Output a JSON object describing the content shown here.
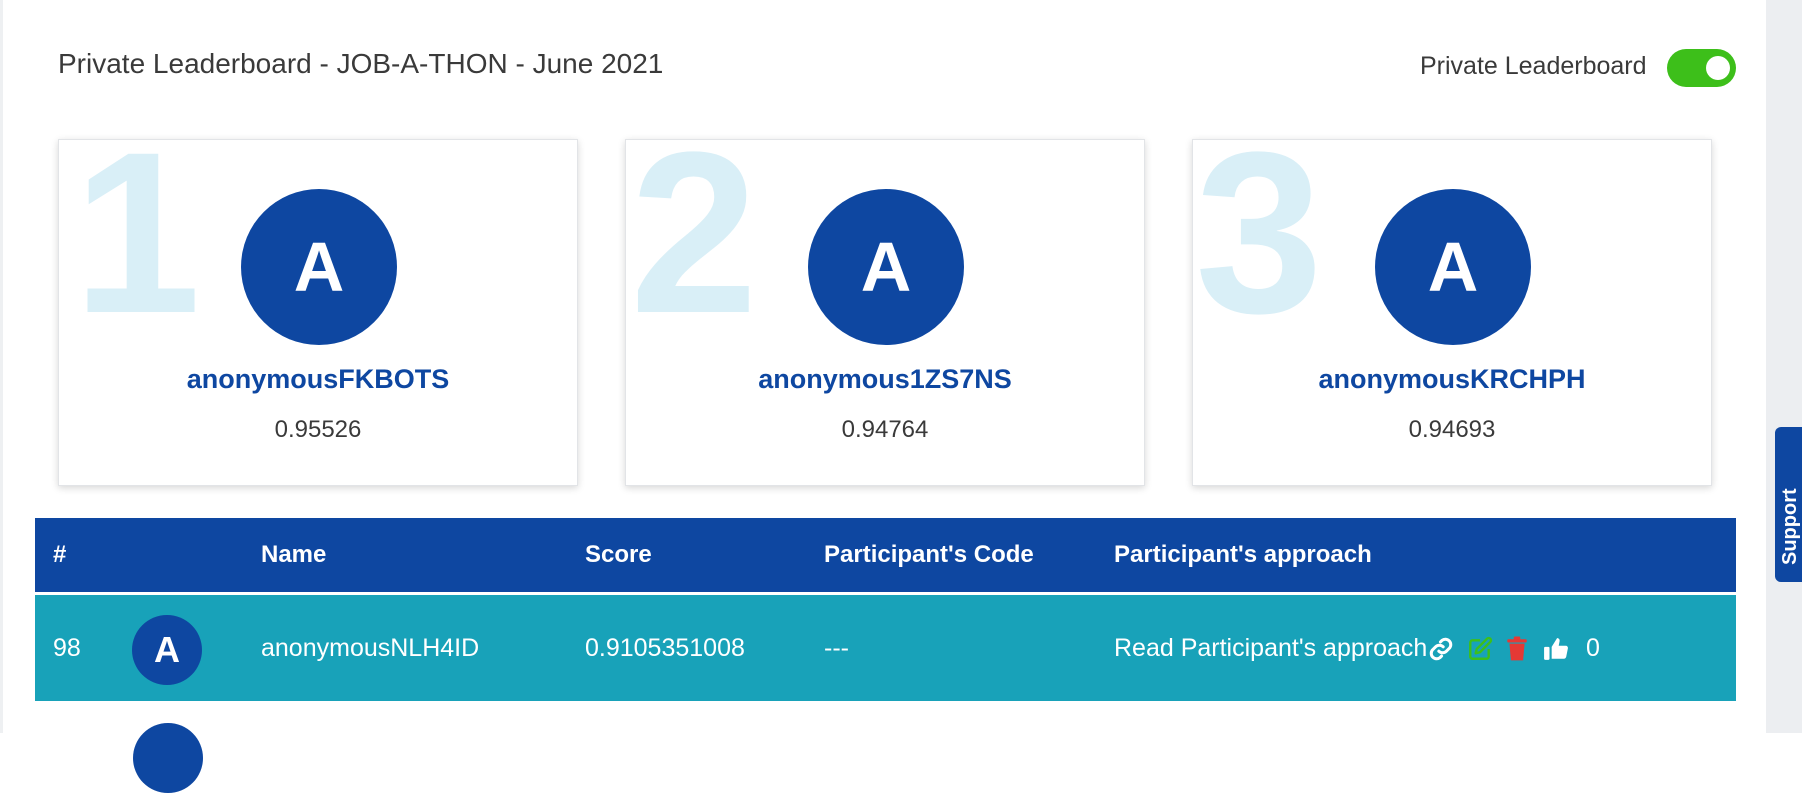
{
  "header": {
    "title": "Private Leaderboard - JOB-A-THON - June 2021",
    "toggle_label": "Private Leaderboard",
    "toggle_on": true
  },
  "podium": [
    {
      "rank": "1",
      "avatar_letter": "A",
      "name": "anonymousFKBOTS",
      "score": "0.95526"
    },
    {
      "rank": "2",
      "avatar_letter": "A",
      "name": "anonymous1ZS7NS",
      "score": "0.94764"
    },
    {
      "rank": "3",
      "avatar_letter": "A",
      "name": "anonymousKRCHPH",
      "score": "0.94693"
    }
  ],
  "table": {
    "headers": [
      "#",
      "Name",
      "Score",
      "Participant's Code",
      "Participant's approach"
    ],
    "rows": [
      {
        "rank": "98",
        "avatar_letter": "A",
        "name": "anonymousNLH4ID",
        "score": "0.9105351008",
        "code": "---",
        "approach_link": "Read Participant's approach",
        "votes": "0"
      }
    ]
  },
  "support": {
    "label": "Support"
  },
  "colors": {
    "primary": "#0e47a1",
    "highlight_row": "#18a2b9",
    "toggle_on": "#3dbf1a",
    "rank_watermark": "#d9eff7",
    "edit_icon": "#3dbf1a",
    "delete_icon": "#e53935"
  },
  "icons": {
    "link": "link-icon",
    "edit": "edit-icon",
    "delete": "trash-icon",
    "upvote": "thumbs-up-icon"
  }
}
